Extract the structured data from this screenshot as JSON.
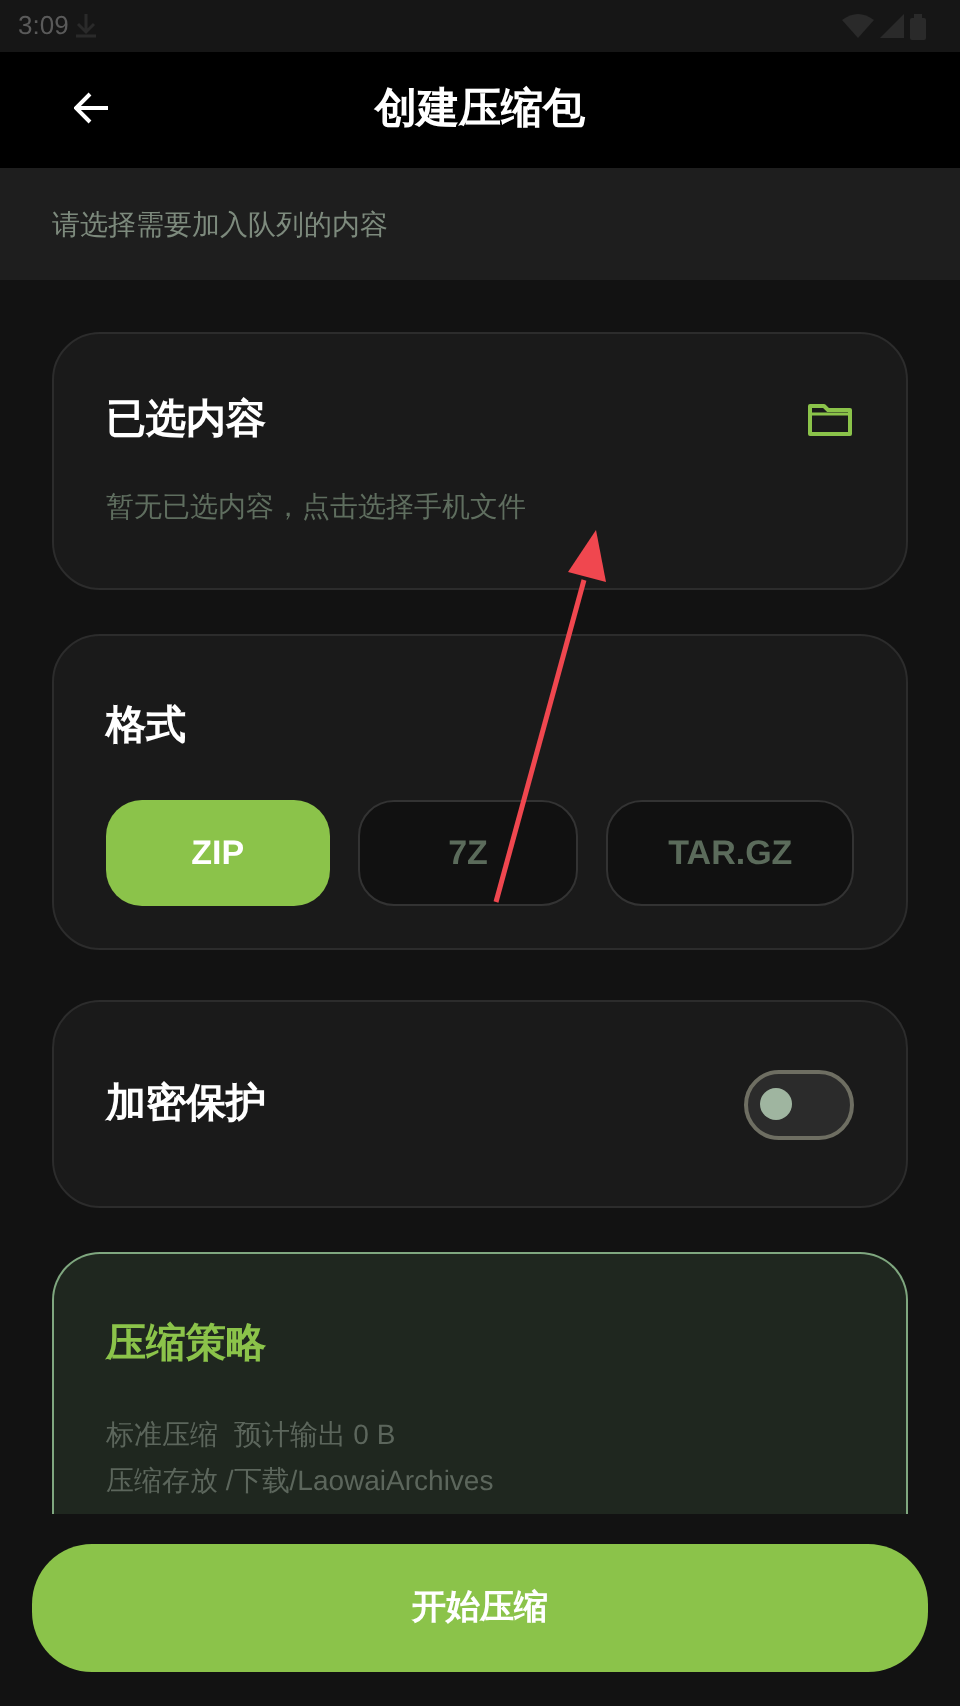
{
  "status_bar": {
    "time": "3:09"
  },
  "header": {
    "title": "创建压缩包"
  },
  "subtitle": "请选择需要加入队列的内容",
  "selected_content": {
    "title": "已选内容",
    "empty_hint": "暂无已选内容，点击选择手机文件"
  },
  "format": {
    "title": "格式",
    "options": [
      {
        "label": "ZIP",
        "selected": true
      },
      {
        "label": "7Z",
        "selected": false
      },
      {
        "label": "TAR.GZ",
        "selected": false
      }
    ]
  },
  "encryption": {
    "label": "加密保护",
    "on": false
  },
  "strategy": {
    "title": "压缩策略",
    "lines": [
      "标准压缩  预计输出 0 B",
      "压缩存放 /下载/LaowaiArchives"
    ]
  },
  "start_button": "开始压缩"
}
